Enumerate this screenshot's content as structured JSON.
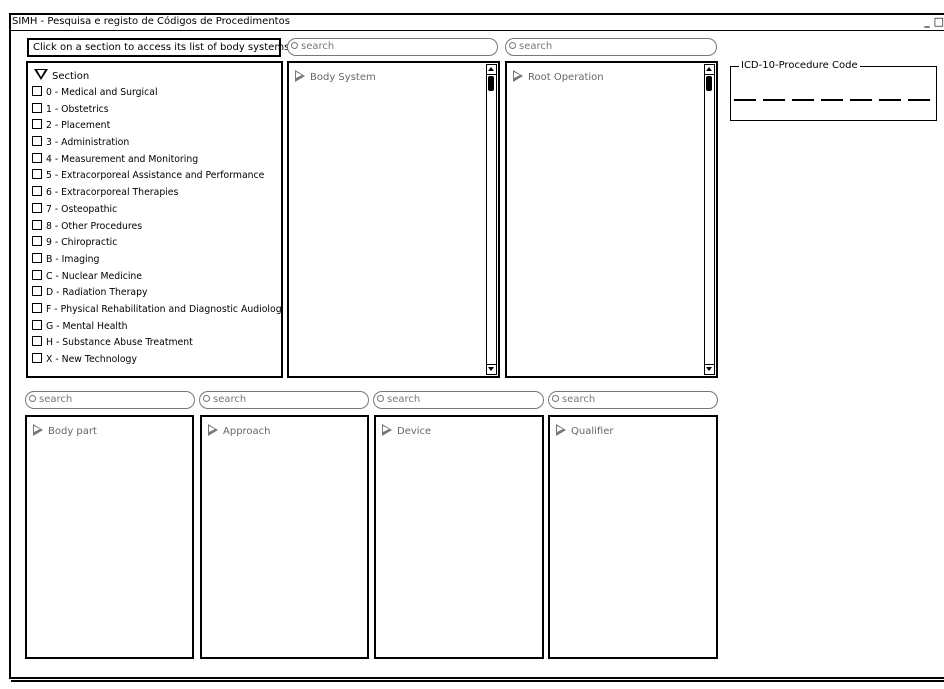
{
  "window": {
    "title": "SIMH - Pesquisa e registo de Códigos de Procedimentos",
    "controls": "_ □"
  },
  "hint": "Click on a section to access its list of body systems",
  "search_placeholder": "search",
  "section": {
    "header": "Section",
    "items": [
      "0 - Medical and Surgical",
      "1 - Obstetrics",
      "2 - Placement",
      "3 - Administration",
      "4 - Measurement and Monitoring",
      "5 - Extracorporeal Assistance and Performance",
      "6 - Extracorporeal Therapies",
      "7 - Osteopathic",
      "8 - Other Procedures",
      "9 - Chiropractic",
      "B - Imaging",
      "C - Nuclear Medicine",
      "D - Radiation Therapy",
      "F - Physical Rehabilitation and Diagnostic Audiology",
      "G - Mental Health",
      "H - Substance Abuse Treatment",
      "X - New Technology"
    ]
  },
  "panels": {
    "body_system": "Body System",
    "root_operation": "Root Operation",
    "body_part": "Body part",
    "approach": "Approach",
    "device": "Device",
    "qualifier": "Qualifier"
  },
  "code_box": {
    "label": "ICD-10-Procedure Code"
  }
}
